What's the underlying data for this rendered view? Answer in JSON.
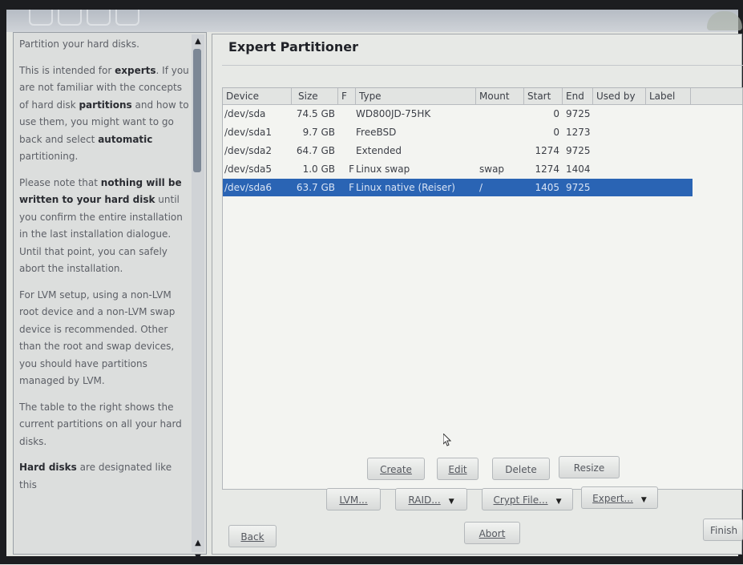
{
  "help": {
    "heading": "Partition your hard disks.",
    "p1a": "This is intended for ",
    "p1b": "experts",
    "p1c": ". If you are not familiar with the concepts of hard disk ",
    "p1d": "partitions",
    "p1e": " and how to use them, you might want to go back and select ",
    "p1f": "automatic",
    "p1g": " partitioning.",
    "p2a": "Please note that ",
    "p2b": "nothing will be written to your hard disk",
    "p2c": " until you confirm the entire installation in the last installation dialogue. Until that point, you can safely abort the installation.",
    "p3": "For LVM setup, using a non-LVM root device and a non-LVM swap device is recommended. Other than the root and swap devices, you should have partitions managed by LVM.",
    "p4": "The table to the right shows the current partitions on all your hard disks.",
    "p5a": "Hard disks",
    "p5b": " are designated like this"
  },
  "title": "Expert Partitioner",
  "table": {
    "headers": {
      "device": "Device",
      "size": "Size",
      "f": "F",
      "type": "Type",
      "mount": "Mount",
      "start": "Start",
      "end": "End",
      "used_by": "Used by",
      "label": "Label"
    },
    "rows": [
      {
        "device": "/dev/sda",
        "size": "74.5 GB",
        "f": "",
        "type": "WD800JD-75HK",
        "mount": "",
        "start": "0",
        "end": "9725"
      },
      {
        "device": "/dev/sda1",
        "size": "9.7 GB",
        "f": "",
        "type": "FreeBSD",
        "mount": "",
        "start": "0",
        "end": "1273"
      },
      {
        "device": "/dev/sda2",
        "size": "64.7 GB",
        "f": "",
        "type": "Extended",
        "mount": "",
        "start": "1274",
        "end": "9725"
      },
      {
        "device": "/dev/sda5",
        "size": "1.0 GB",
        "f": "F",
        "type": "Linux swap",
        "mount": "swap",
        "start": "1274",
        "end": "1404"
      },
      {
        "device": "/dev/sda6",
        "size": "63.7 GB",
        "f": "F",
        "type": "Linux native (Reiser)",
        "mount": "/",
        "start": "1405",
        "end": "9725"
      }
    ],
    "selected_row": 4
  },
  "buttons": {
    "create": "Create",
    "edit": "Edit",
    "delete": "Delete",
    "resize": "Resize",
    "lvm": "LVM...",
    "raid": "RAID...",
    "crypt": "Crypt File...",
    "expert": "Expert...",
    "back": "Back",
    "abort": "Abort",
    "finish": "Finish"
  },
  "colors": {
    "selection": "#2a64b4",
    "background": "#e7e9e6"
  }
}
